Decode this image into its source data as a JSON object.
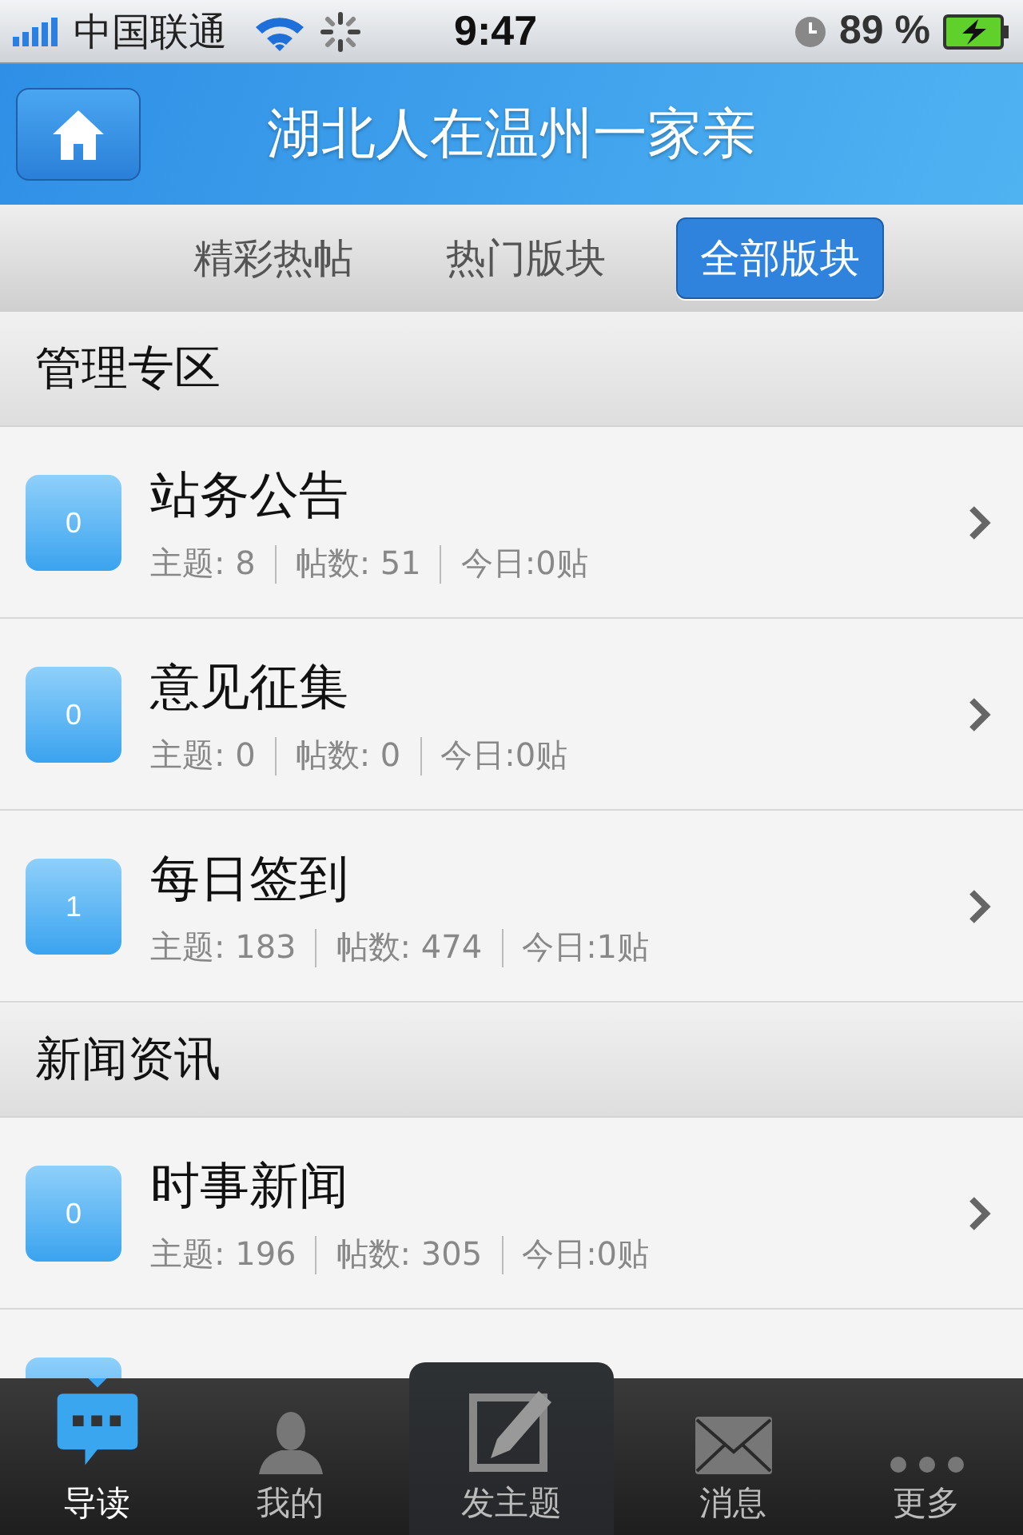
{
  "status_bar": {
    "carrier": "中国联通",
    "time": "9:47",
    "battery": "89 %"
  },
  "header": {
    "title": "湖北人在温州一家亲"
  },
  "tabs": [
    {
      "label": "精彩热帖",
      "selected": false
    },
    {
      "label": "热门版块",
      "selected": false
    },
    {
      "label": "全部版块",
      "selected": true
    }
  ],
  "sections": [
    {
      "title": "管理专区",
      "boards": [
        {
          "badge": "0",
          "name": "站务公告",
          "topics": "主题: 8",
          "posts": "帖数: 51",
          "today": "今日:0贴"
        },
        {
          "badge": "0",
          "name": "意见征集",
          "topics": "主题: 0",
          "posts": "帖数: 0",
          "today": "今日:0贴"
        },
        {
          "badge": "1",
          "name": "每日签到",
          "topics": "主题: 183",
          "posts": "帖数: 474",
          "today": "今日:1贴"
        }
      ]
    },
    {
      "title": "新闻资讯",
      "boards": [
        {
          "badge": "0",
          "name": "时事新闻",
          "topics": "主题: 196",
          "posts": "帖数: 305",
          "today": "今日:0贴"
        }
      ],
      "more_rows_below": true
    }
  ],
  "tab_bar": [
    {
      "kind": "guide",
      "label": "导读",
      "selected": true
    },
    {
      "kind": "person",
      "label": "我的",
      "selected": false
    },
    {
      "kind": "compose",
      "label": "发主题",
      "selected": false
    },
    {
      "kind": "mail",
      "label": "消息",
      "selected": false
    },
    {
      "kind": "more",
      "label": "更多",
      "selected": false
    }
  ]
}
